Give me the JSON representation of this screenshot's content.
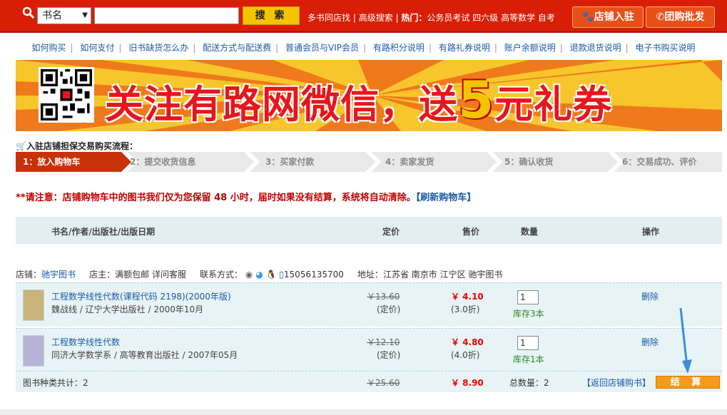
{
  "header": {
    "search_type": "书名",
    "search_value": "",
    "search_button": "搜 索",
    "links": [
      "多书同店找",
      "高级搜索"
    ],
    "hot_label": "热门：",
    "hot_links": [
      "公务员考试",
      "四六级",
      "高等数学",
      "自考"
    ],
    "shop_join": "店铺入驻",
    "group_buy": "团购批发"
  },
  "nav": [
    "如何购买",
    "如何支付",
    "旧书缺货怎么办",
    "配送方式与配送费",
    "普通会员与VIP会员",
    "有路积分说明",
    "有路礼券说明",
    "账户余额说明",
    "退款退货说明",
    "电子书购买说明"
  ],
  "banner": {
    "text_a": "关注有路网微信，送",
    "five": "5",
    "text_b": "元礼券"
  },
  "flow": {
    "title": "入驻店铺担保交易购买流程：",
    "steps": [
      "1：放入购物车",
      "2：提交收货信息",
      "3：买家付款",
      "4：卖家发货",
      "5：确认收货",
      "6：交易成功、评价"
    ]
  },
  "notice": {
    "text": "**请注意：店铺购物车中的图书我们仅为您保留 48 小时，届时如果没有结算，系统将自动清除。",
    "refresh": "【刷新购物车】"
  },
  "table_head": {
    "book": "书名/作者/出版社/出版日期",
    "list": "定价",
    "sale": "售价",
    "qty": "数量",
    "op": "操作"
  },
  "shop": {
    "shop_label": "店铺：",
    "shop_name": "驰宇图书",
    "owner_label": "店主：",
    "owner": "满额包邮 详问客服",
    "contact_label": "联系方式：",
    "phone": "15056135700",
    "addr_label": "地址：",
    "address": "江苏省 南京市 江宁区 驰宇图书"
  },
  "items": [
    {
      "title": "工程数学线性代数(课程代码 2198)(2000年版)",
      "meta": "魏战线 / 辽宁大学出版社 / 2000年10月",
      "list": "￥13.60",
      "list_sub": "(定价)",
      "sale": "￥ 4.10",
      "disc": "(3.0折)",
      "qty": "1",
      "stock": "库存3本",
      "del": "删除"
    },
    {
      "title": "工程数学线性代数",
      "meta": "同济大学数学系 / 高等教育出版社 / 2007年05月",
      "list": "￥12.10",
      "list_sub": "(定价)",
      "sale": "￥ 4.80",
      "disc": "(4.0折)",
      "qty": "1",
      "stock": "库存1本",
      "del": "删除"
    }
  ],
  "footer": {
    "kinds": "图书种类共计：2",
    "list_total": "￥25.60",
    "sale_total": "￥ 8.90",
    "qty_total": "总数量：2",
    "back": "【返回店铺购书】",
    "checkout": "结 算"
  },
  "colors": {
    "red": "#d81e06",
    "orange": "#f59a1a",
    "link": "#1a5aa6",
    "row_bg": "#e8f3f6"
  }
}
